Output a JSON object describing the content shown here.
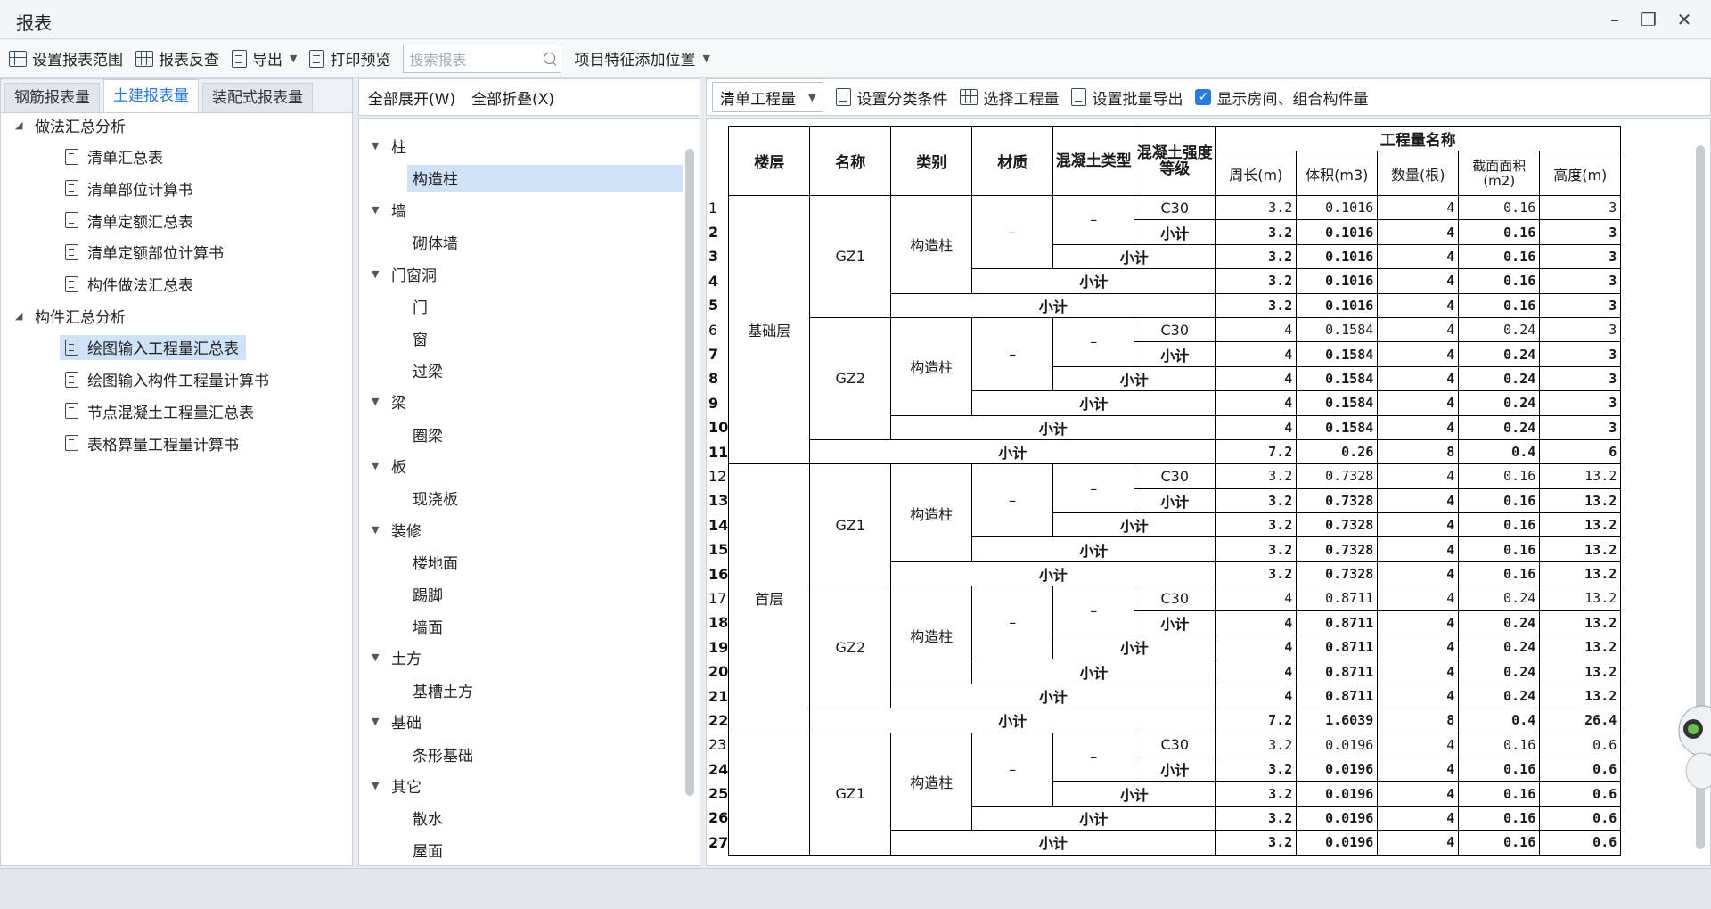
{
  "window": {
    "title": "报表"
  },
  "toolbar": {
    "set_range": "设置报表范围",
    "report_check": "报表反查",
    "export": "导出",
    "print_preview": "打印预览",
    "search_placeholder": "搜索报表",
    "add_position": "项目特征添加位置"
  },
  "left": {
    "tabs": [
      "钢筋报表量",
      "土建报表量",
      "装配式报表量"
    ],
    "groups": [
      {
        "label": "做法汇总分析",
        "items": [
          "清单汇总表",
          "清单部位计算书",
          "清单定额汇总表",
          "清单定额部位计算书",
          "构件做法汇总表"
        ]
      },
      {
        "label": "构件汇总分析",
        "items": [
          "绘图输入工程量汇总表",
          "绘图输入构件工程量计算书",
          "节点混凝土工程量汇总表",
          "表格算量工程量计算书"
        ]
      }
    ],
    "selected": "绘图输入工程量汇总表"
  },
  "middle": {
    "expand_all": "全部展开(W)",
    "collapse_all": "全部折叠(X)",
    "categories": [
      {
        "label": "柱",
        "items": [
          "构造柱"
        ]
      },
      {
        "label": "墙",
        "items": [
          "砌体墙"
        ]
      },
      {
        "label": "门窗洞",
        "items": [
          "门",
          "窗",
          "过梁"
        ]
      },
      {
        "label": "梁",
        "items": [
          "圈梁"
        ]
      },
      {
        "label": "板",
        "items": [
          "现浇板"
        ]
      },
      {
        "label": "装修",
        "items": [
          "楼地面",
          "踢脚",
          "墙面"
        ]
      },
      {
        "label": "土方",
        "items": [
          "基槽土方"
        ]
      },
      {
        "label": "基础",
        "items": [
          "条形基础"
        ]
      },
      {
        "label": "其它",
        "items": [
          "散水",
          "屋面"
        ]
      }
    ],
    "selected": "构造柱"
  },
  "right": {
    "qty_select": "清单工程量",
    "set_classify": "设置分类条件",
    "select_qty": "选择工程量",
    "batch_export": "设置批量导出",
    "show_rooms": "显示房间、组合构件量",
    "headers": {
      "floor": "楼层",
      "name": "名称",
      "category": "类别",
      "material": "材质",
      "concrete_type": "混凝土类型",
      "concrete_grade": "混凝土强度等级",
      "group": "工程量名称",
      "perimeter": "周长(m)",
      "volume": "体积(m3)",
      "count": "数量(根)",
      "area": "截面面积(m2)",
      "height": "高度(m)"
    },
    "floors": [
      "基础层",
      "首层"
    ],
    "names": [
      "GZ1",
      "GZ2",
      "GZ1",
      "GZ2",
      "GZ1"
    ],
    "cat_label": "构造柱",
    "dash": "–",
    "subtotal": "小计",
    "grade": "C30",
    "rows": [
      [
        "3.2",
        "0.1016",
        "4",
        "0.16",
        "3"
      ],
      [
        "3.2",
        "0.1016",
        "4",
        "0.16",
        "3"
      ],
      [
        "3.2",
        "0.1016",
        "4",
        "0.16",
        "3"
      ],
      [
        "3.2",
        "0.1016",
        "4",
        "0.16",
        "3"
      ],
      [
        "3.2",
        "0.1016",
        "4",
        "0.16",
        "3"
      ],
      [
        "4",
        "0.1584",
        "4",
        "0.24",
        "3"
      ],
      [
        "4",
        "0.1584",
        "4",
        "0.24",
        "3"
      ],
      [
        "4",
        "0.1584",
        "4",
        "0.24",
        "3"
      ],
      [
        "4",
        "0.1584",
        "4",
        "0.24",
        "3"
      ],
      [
        "4",
        "0.1584",
        "4",
        "0.24",
        "3"
      ],
      [
        "7.2",
        "0.26",
        "8",
        "0.4",
        "6"
      ],
      [
        "3.2",
        "0.7328",
        "4",
        "0.16",
        "13.2"
      ],
      [
        "3.2",
        "0.7328",
        "4",
        "0.16",
        "13.2"
      ],
      [
        "3.2",
        "0.7328",
        "4",
        "0.16",
        "13.2"
      ],
      [
        "3.2",
        "0.7328",
        "4",
        "0.16",
        "13.2"
      ],
      [
        "3.2",
        "0.7328",
        "4",
        "0.16",
        "13.2"
      ],
      [
        "4",
        "0.8711",
        "4",
        "0.24",
        "13.2"
      ],
      [
        "4",
        "0.8711",
        "4",
        "0.24",
        "13.2"
      ],
      [
        "4",
        "0.8711",
        "4",
        "0.24",
        "13.2"
      ],
      [
        "4",
        "0.8711",
        "4",
        "0.24",
        "13.2"
      ],
      [
        "4",
        "0.8711",
        "4",
        "0.24",
        "13.2"
      ],
      [
        "7.2",
        "1.6039",
        "8",
        "0.4",
        "26.4"
      ],
      [
        "3.2",
        "0.0196",
        "4",
        "0.16",
        "0.6"
      ],
      [
        "3.2",
        "0.0196",
        "4",
        "0.16",
        "0.6"
      ],
      [
        "3.2",
        "0.0196",
        "4",
        "0.16",
        "0.6"
      ],
      [
        "3.2",
        "0.0196",
        "4",
        "0.16",
        "0.6"
      ],
      [
        "3.2",
        "0.0196",
        "4",
        "0.16",
        "0.6"
      ]
    ]
  }
}
